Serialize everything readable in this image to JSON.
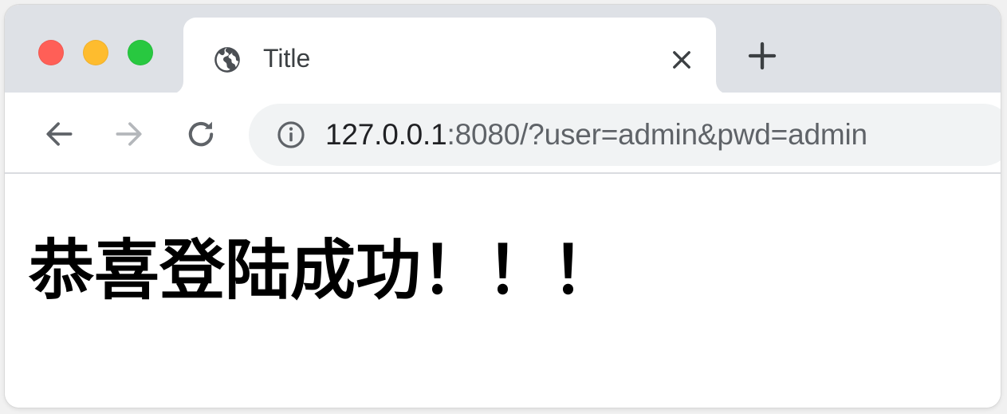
{
  "window": {
    "traffic_lights": {
      "close_color": "#ff5f57",
      "minimize_color": "#febc2e",
      "maximize_color": "#28c840"
    }
  },
  "tab": {
    "title": "Title",
    "favicon": "globe-icon",
    "close_icon": "close-icon"
  },
  "new_tab_icon": "plus-icon",
  "toolbar": {
    "back_icon": "arrow-left-icon",
    "forward_icon": "arrow-right-icon",
    "reload_icon": "reload-icon"
  },
  "address_bar": {
    "security_icon": "info-icon",
    "url_host": "127.0.0.1",
    "url_rest": ":8080/?user=admin&pwd=admin"
  },
  "page": {
    "heading": "恭喜登陆成功！！！"
  }
}
